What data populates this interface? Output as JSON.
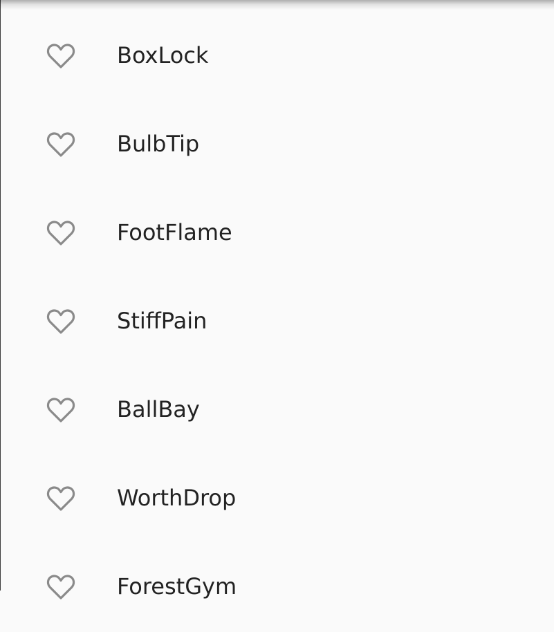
{
  "colors": {
    "background": "#fafafa",
    "text": "#222222",
    "icon": "#8a8a8a"
  },
  "list": {
    "items": [
      {
        "label": "BoxLock",
        "icon": "heart-outline-icon",
        "favorited": false
      },
      {
        "label": "BulbTip",
        "icon": "heart-outline-icon",
        "favorited": false
      },
      {
        "label": "FootFlame",
        "icon": "heart-outline-icon",
        "favorited": false
      },
      {
        "label": "StiffPain",
        "icon": "heart-outline-icon",
        "favorited": false
      },
      {
        "label": "BallBay",
        "icon": "heart-outline-icon",
        "favorited": false
      },
      {
        "label": "WorthDrop",
        "icon": "heart-outline-icon",
        "favorited": false
      },
      {
        "label": "ForestGym",
        "icon": "heart-outline-icon",
        "favorited": false
      }
    ]
  }
}
